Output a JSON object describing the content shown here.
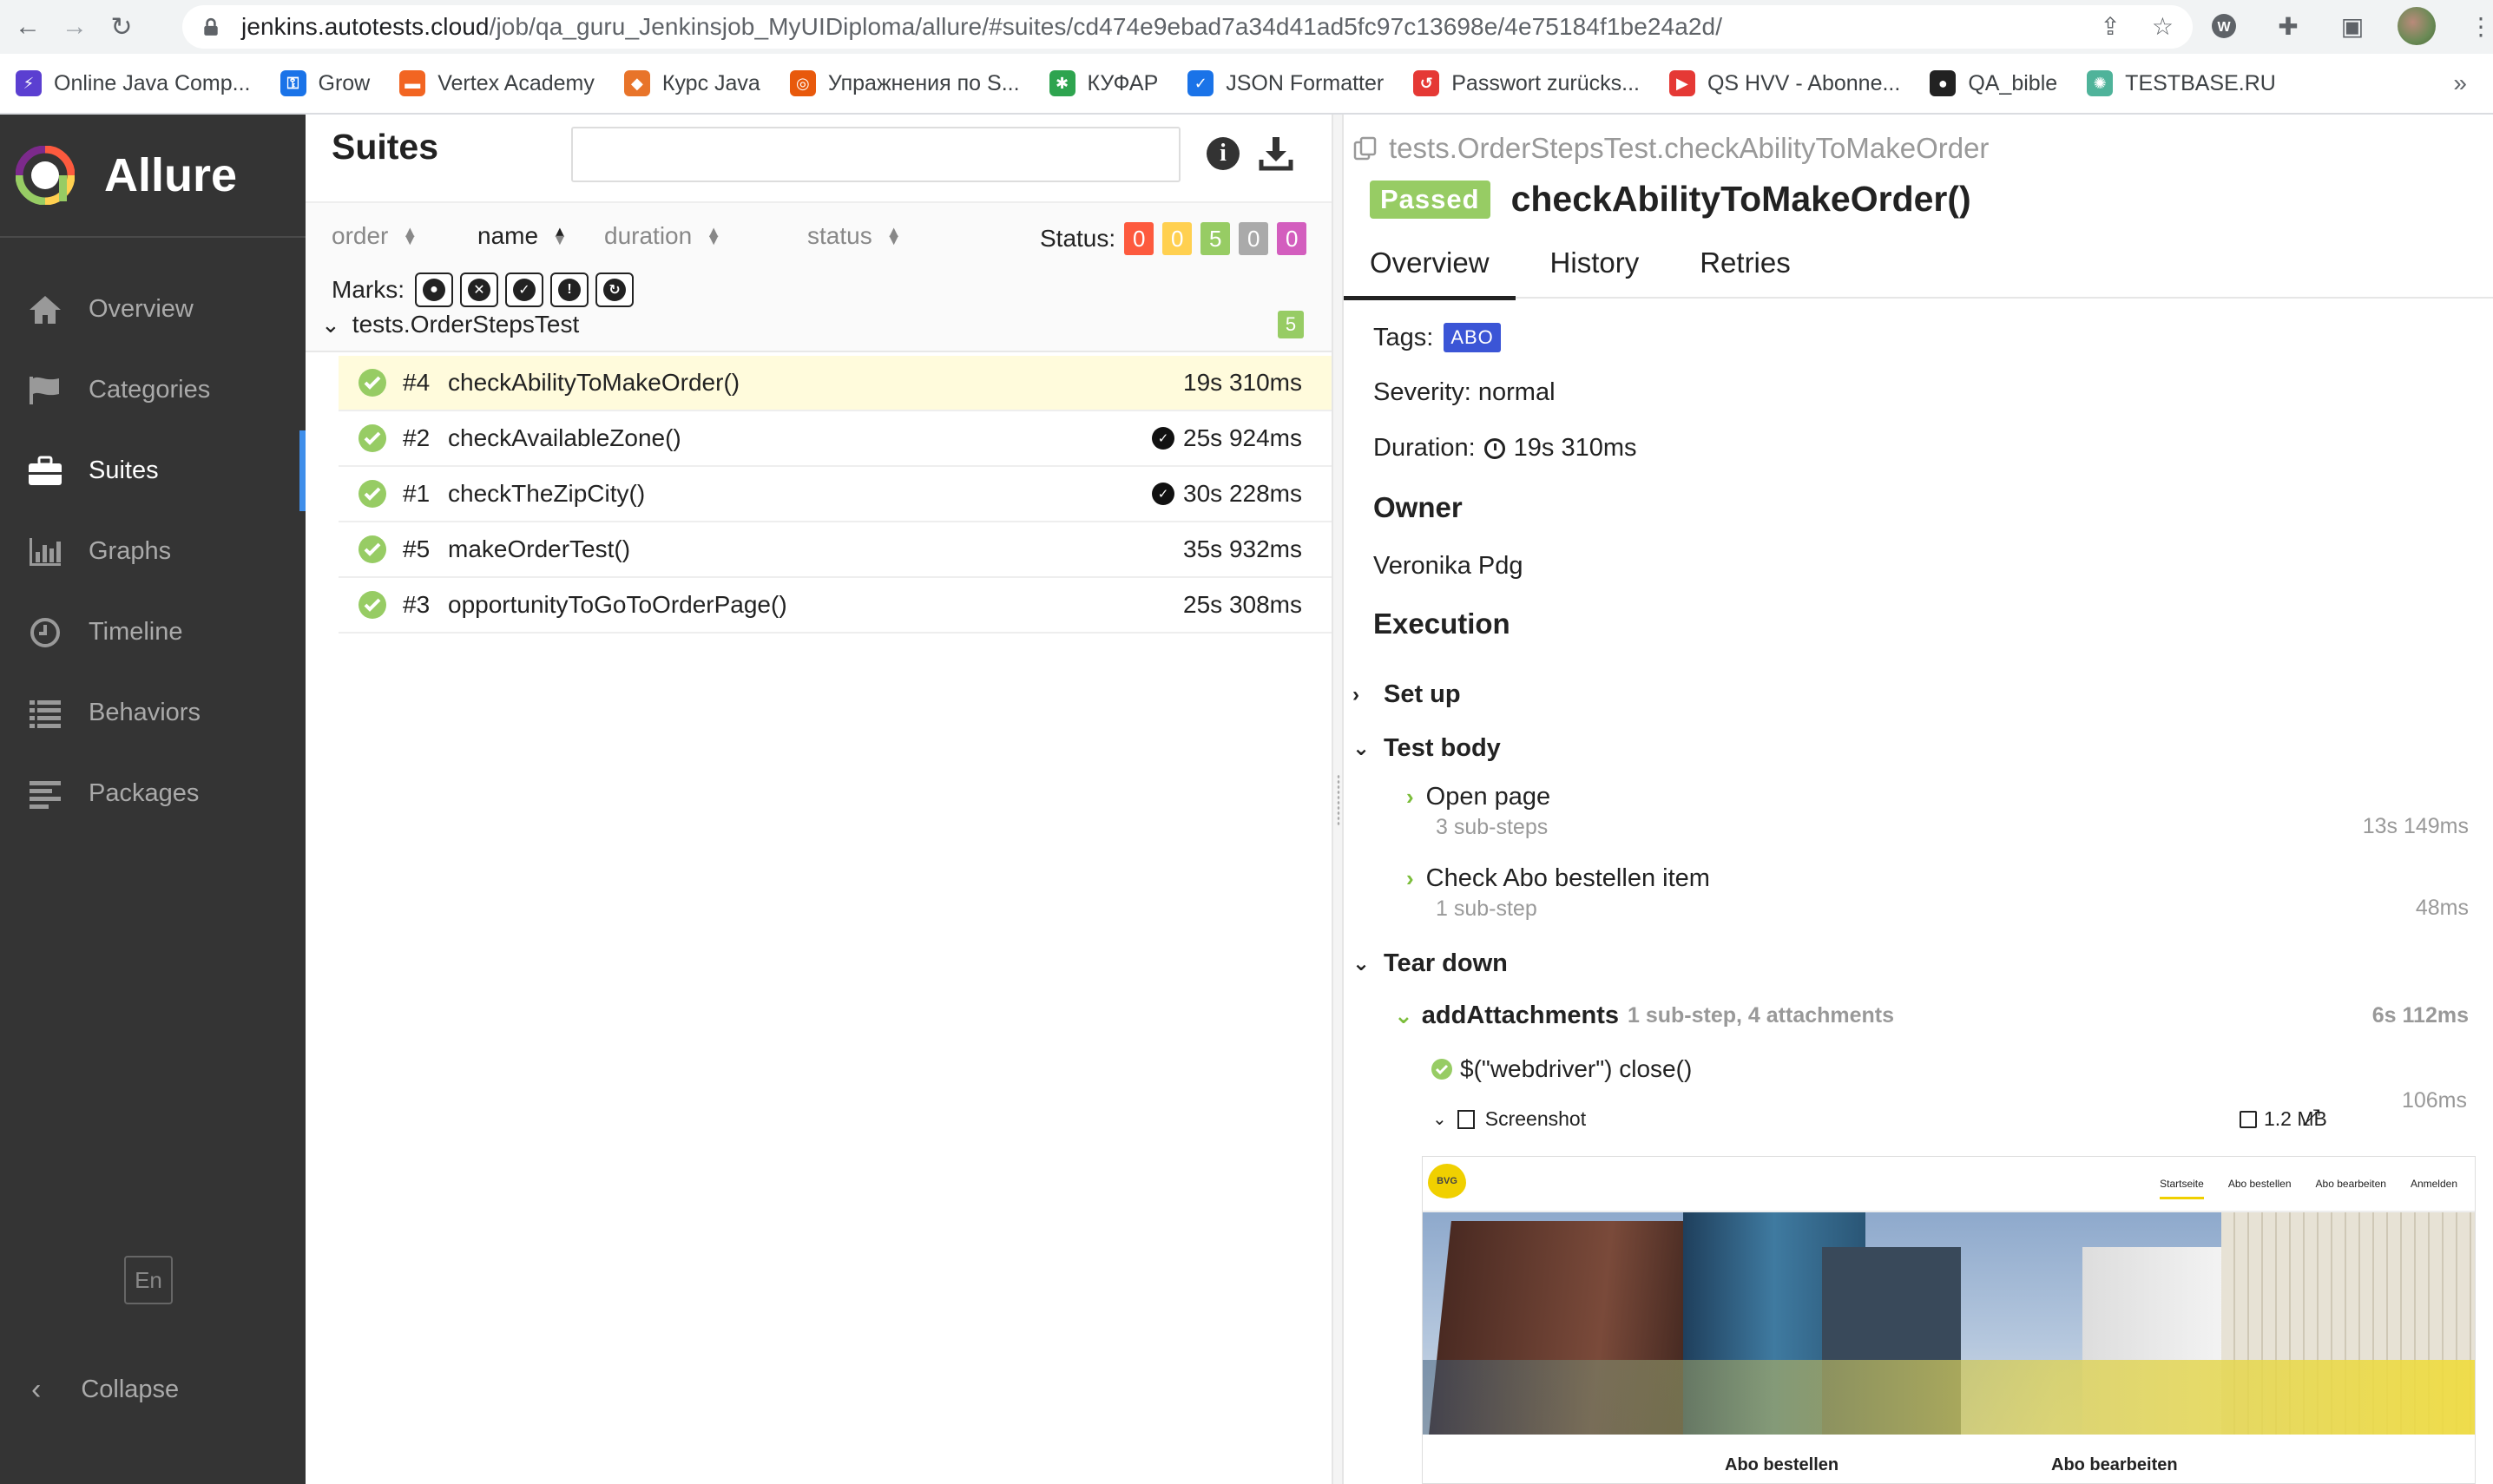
{
  "browser": {
    "url_host": "jenkins.autotests.cloud",
    "url_path": "/job/qa_guru_Jenkinsjob_MyUIDiploma/allure/#suites/cd474e9ebad7a34d41ad5fc97c13698e/4e75184f1be24a2d/",
    "bookmarks": [
      {
        "label": "Online Java Comp...",
        "icon": "bolt-icon",
        "color": "#5b3fd1"
      },
      {
        "label": "Grow",
        "icon": "key-icon",
        "color": "#1a73e8"
      },
      {
        "label": "Vertex Academy",
        "icon": "vertex-icon",
        "color": "#f26522"
      },
      {
        "label": "Курс Java",
        "icon": "java-icon",
        "color": "#e8742a"
      },
      {
        "label": "Упражнения по S...",
        "icon": "target-icon",
        "color": "#e8590c"
      },
      {
        "label": "КУФАР",
        "icon": "kufar-icon",
        "color": "#2ea44f"
      },
      {
        "label": "JSON Formatter",
        "icon": "check-icon",
        "color": "#1a73e8"
      },
      {
        "label": "Passwort zurücks...",
        "icon": "refresh-icon",
        "color": "#e53935"
      },
      {
        "label": "QS HVV - Abonne...",
        "icon": "play-icon",
        "color": "#e53935"
      },
      {
        "label": "QA_bible",
        "icon": "github-icon",
        "color": "#222222"
      },
      {
        "label": "TESTBASE.RU",
        "icon": "gear-icon",
        "color": "#4fb39a"
      }
    ],
    "bookmarks_more": "»"
  },
  "sidebar": {
    "brand": "Allure",
    "items": [
      {
        "label": "Overview",
        "icon": "home-icon"
      },
      {
        "label": "Categories",
        "icon": "flag-icon"
      },
      {
        "label": "Suites",
        "icon": "briefcase-icon"
      },
      {
        "label": "Graphs",
        "icon": "bar-chart-icon"
      },
      {
        "label": "Timeline",
        "icon": "clock-icon"
      },
      {
        "label": "Behaviors",
        "icon": "list-icon"
      },
      {
        "label": "Packages",
        "icon": "align-left-icon"
      }
    ],
    "active": "Suites",
    "lang": "En",
    "collapse": "Collapse"
  },
  "suites": {
    "title": "Suites",
    "search_placeholder": "",
    "sort": {
      "order": "order",
      "name": "name",
      "duration": "duration",
      "status": "status"
    },
    "status_label": "Status:",
    "status_counts": [
      {
        "value": "0",
        "color": "#fd5a3e"
      },
      {
        "value": "0",
        "color": "#ffd050"
      },
      {
        "value": "5",
        "color": "#97cc64"
      },
      {
        "value": "0",
        "color": "#aaaaaa"
      },
      {
        "value": "0",
        "color": "#d35ebe"
      }
    ],
    "marks_label": "Marks:",
    "group": {
      "name": "tests.OrderStepsTest",
      "count": "5"
    },
    "tests": [
      {
        "num": "#4",
        "name": "checkAbilityToMakeOrder()",
        "duration": "19s 310ms",
        "flaky": false,
        "selected": true
      },
      {
        "num": "#2",
        "name": "checkAvailableZone()",
        "duration": "25s 924ms",
        "flaky": true,
        "selected": false
      },
      {
        "num": "#1",
        "name": "checkTheZipCity()",
        "duration": "30s 228ms",
        "flaky": true,
        "selected": false
      },
      {
        "num": "#5",
        "name": "makeOrderTest()",
        "duration": "35s 932ms",
        "flaky": false,
        "selected": false
      },
      {
        "num": "#3",
        "name": "opportunityToGoToOrderPage()",
        "duration": "25s 308ms",
        "flaky": false,
        "selected": false
      }
    ]
  },
  "detail": {
    "breadcrumb": "tests.OrderStepsTest.checkAbilityToMakeOrder",
    "status": "Passed",
    "title": "checkAbilityToMakeOrder()",
    "tabs": [
      "Overview",
      "History",
      "Retries"
    ],
    "tags_label": "Tags:",
    "tag": "ABO",
    "severity": "Severity: normal",
    "duration_label": "Duration:",
    "duration": "19s 310ms",
    "owner_heading": "Owner",
    "owner": "Veronika Pdg",
    "execution_heading": "Execution",
    "setup": "Set up",
    "test_body": "Test body",
    "steps": [
      {
        "name": "Open page",
        "sub": "3 sub-steps",
        "duration": "13s 149ms"
      },
      {
        "name": "Check Abo bestellen item",
        "sub": "1 sub-step",
        "duration": "48ms"
      }
    ],
    "tear_down": "Tear down",
    "attachments_step": {
      "name": "addAttachments",
      "meta": "1 sub-step, 4 attachments",
      "duration": "6s 112ms"
    },
    "close_step": {
      "name": "$(\"webdriver\") close()",
      "duration": "106ms"
    },
    "screenshot": {
      "name": "Screenshot",
      "size": "1.2 MB"
    },
    "preview": {
      "logo": "BVG",
      "nav": [
        "Startseite",
        "Abo bestellen",
        "Abo bearbeiten",
        "Anmelden"
      ],
      "labels": [
        "Abo bestellen",
        "Abo bearbeiten"
      ]
    }
  }
}
